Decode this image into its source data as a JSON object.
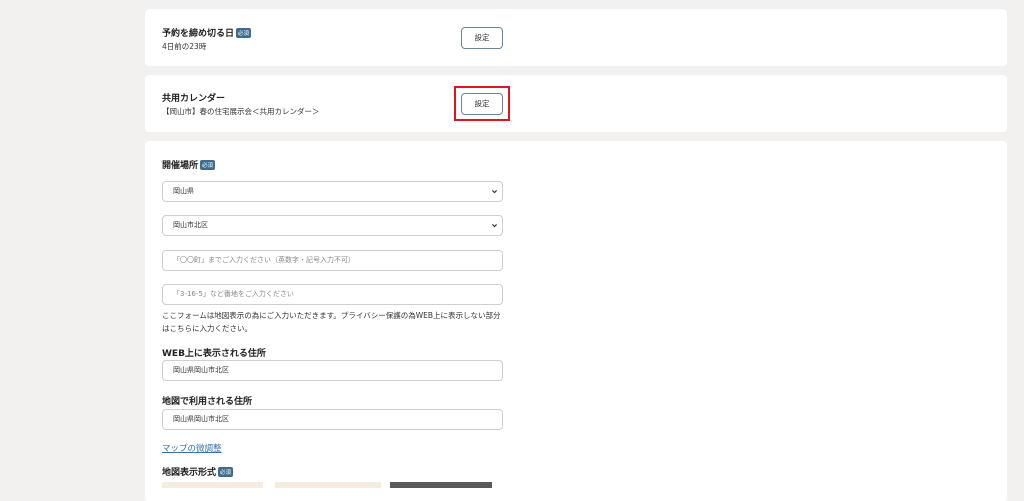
{
  "deadline": {
    "title": "予約を締め切る日",
    "badge": "必須",
    "value": "4日前の23時",
    "button": "設定"
  },
  "calendar": {
    "title": "共用カレンダー",
    "value": "【岡山市】春の住宅展示会＜共用カレンダー＞",
    "button": "設定"
  },
  "venue": {
    "title": "開催場所",
    "badge": "必須",
    "prefecture": "岡山県",
    "city": "岡山市北区",
    "town_placeholder": "「〇〇町」までご入力ください（英数字・記号入力不可）",
    "address_placeholder": "「3-16-5」など番地をご入力ください",
    "note": "ここフォームは地図表示の為にご入力いただきます。プライバシー保護の為WEB上に表示しない部分はこちらに入力ください。",
    "web_address_label": "WEB上に表示される住所",
    "web_address_value": "岡山県岡山市北区",
    "map_address_label": "地図で利用される住所",
    "map_address_value": "岡山県岡山市北区",
    "map_adjust_link": "マップの微調整",
    "map_format_label": "地図表示形式",
    "map_format_badge": "必須"
  },
  "colors": {
    "badge": "#3f6c8b",
    "highlight": "#e0141c",
    "link": "#3a6fa8",
    "background": "#f2f1ef"
  }
}
